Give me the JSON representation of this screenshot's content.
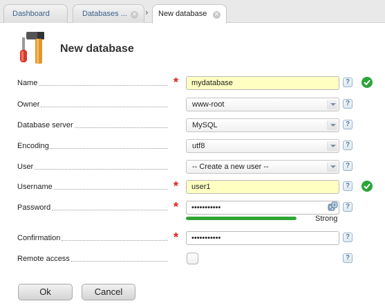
{
  "tabs": [
    {
      "label": "Dashboard"
    },
    {
      "label": "Databases ..."
    },
    {
      "label": "New database"
    }
  ],
  "page": {
    "title": "New database"
  },
  "form": {
    "name": {
      "label": "Name",
      "value": "mydatabase"
    },
    "owner": {
      "label": "Owner",
      "value": "www-root"
    },
    "database_server": {
      "label": "Database server",
      "value": "MySQL"
    },
    "encoding": {
      "label": "Encoding",
      "value": "utf8"
    },
    "user": {
      "label": "User",
      "value": "-- Create a new user --"
    },
    "username": {
      "label": "Username",
      "value": "user1"
    },
    "password": {
      "label": "Password",
      "value": "•••••••••••",
      "strength_label": "Strong",
      "strength_fraction": 1.0
    },
    "confirmation": {
      "label": "Confirmation",
      "value": "•••••••••••"
    },
    "remote_access": {
      "label": "Remote access",
      "checked": false
    }
  },
  "common": {
    "required_mark": "*",
    "help_mark": "?"
  },
  "buttons": {
    "ok": "Ok",
    "cancel": "Cancel"
  },
  "colors": {
    "accent_green": "#2aa53a",
    "required_red": "#e02020",
    "valid_input_bg": "#ffffc2"
  },
  "icons": [
    "tools-icon",
    "close-icon",
    "chevron-right-icon",
    "help-icon",
    "checkmark-icon",
    "dice-icon"
  ]
}
